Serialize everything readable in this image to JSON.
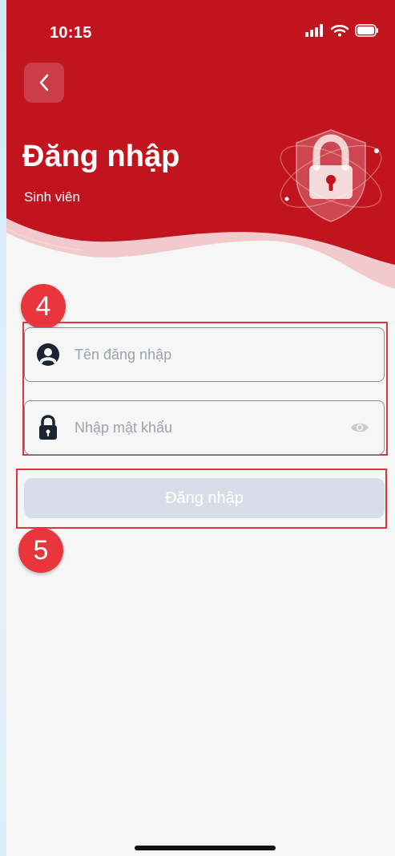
{
  "status_bar": {
    "time": "10:15"
  },
  "header": {
    "title": "Đăng nhập",
    "subtitle": "Sinh viên",
    "brand_color": "#c1141f"
  },
  "form": {
    "username": {
      "placeholder": "Tên đăng nhập",
      "value": ""
    },
    "password": {
      "placeholder": "Nhập mật khẩu",
      "value": ""
    },
    "submit_label": "Đăng nhập"
  },
  "annotations": {
    "badge_4": "4",
    "badge_5": "5"
  },
  "icons": [
    "back-chevron-icon",
    "signal-icon",
    "wifi-icon",
    "battery-icon",
    "lock-shield-illustration",
    "user-circle-icon",
    "lock-icon",
    "eye-icon"
  ]
}
